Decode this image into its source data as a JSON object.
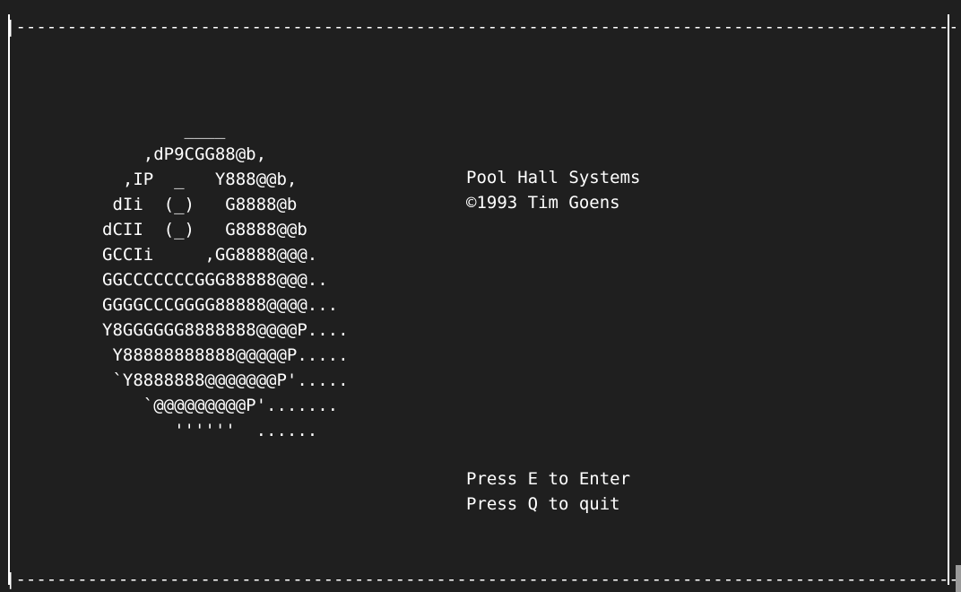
{
  "border": {
    "top": "|--------------------------------------------------------------------------------------------------------------|",
    "bottom": "|--------------------------------------------------------------------------------------------------------------|"
  },
  "ascii_art": "        ____\n    ,dP9CGG88@b,\n  ,IP  _   Y888@@b,\n dIi  (_)   G8888@b\ndCII  (_)   G8888@@b\nGCCIi     ,GG8888@@@.\nGGCCCCCCCGGG88888@@@..\nGGGGCCCGGGG88888@@@@...\nY8GGGGGG8888888@@@@P....\n Y88888888888@@@@@P.....\n `Y8888888@@@@@@@P'.....\n    `@@@@@@@@@P'.......\n       ''''''  ......",
  "info": {
    "title": "Pool Hall Systems",
    "copyright": "©1993 Tim Goens",
    "press_enter": "Press E to Enter",
    "press_quit": "Press Q to quit"
  }
}
